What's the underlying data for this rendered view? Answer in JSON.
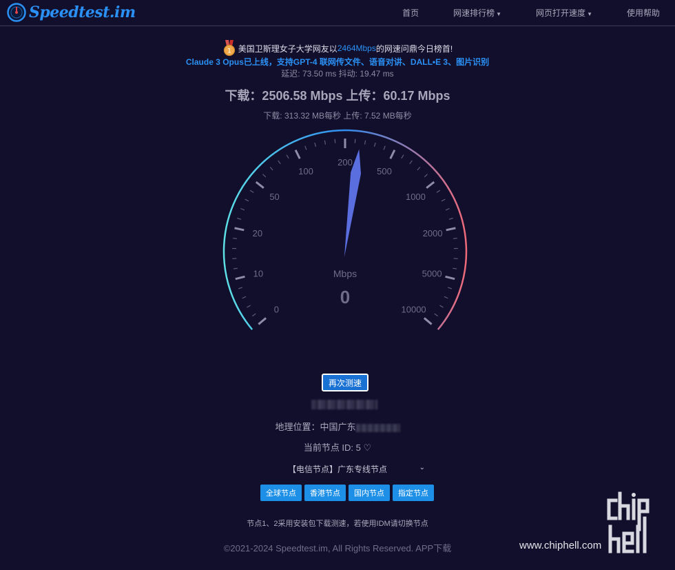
{
  "brand": {
    "name": "Speedtest.im"
  },
  "nav": {
    "items": [
      {
        "label": "首页",
        "dropdown": false
      },
      {
        "label": "网速排行榜",
        "dropdown": true
      },
      {
        "label": "网页打开速度",
        "dropdown": true
      },
      {
        "label": "使用帮助",
        "dropdown": false
      }
    ]
  },
  "announcement": {
    "prefix": "美国卫斯理女子大学网友以",
    "highlight": "2464Mbps",
    "suffix": "的网速问鼎今日榜首!"
  },
  "promo": "Claude 3 Opus已上线，支持GPT-4 联网传文件、语音对讲、DALL•E 3、图片识别",
  "latency": "延迟: 73.50 ms 抖动: 19.47 ms",
  "speeds": "下载：2506.58 Mbps 上传：60.17 Mbps",
  "speeds_mb": "下载: 313.32 MB每秒 上传: 7.52 MB每秒",
  "gauge": {
    "labels": [
      "0",
      "10",
      "20",
      "50",
      "100",
      "200",
      "500",
      "1000",
      "2000",
      "5000",
      "10000"
    ],
    "unit": "Mbps",
    "value": "0",
    "needle_fraction": 0.53,
    "colors": {
      "arc_start": "#5de0e6",
      "arc_mid": "#2f8cf0",
      "arc_end": "#f06a7a",
      "needle": "#5b6ee0"
    }
  },
  "retest_label": "再次测速",
  "location": {
    "label": "地理位置：中国广东"
  },
  "node": {
    "label": "当前节点 ID: 5",
    "heart": "♡"
  },
  "node_select": {
    "value": "【电信节点】广东专线节点"
  },
  "node_buttons": [
    "全球节点",
    "香港节点",
    "国内节点",
    "指定节点"
  ],
  "tip": "节点1、2采用安装包下载测速，若使用IDM请切换节点",
  "footer": {
    "copyright": "©2021-2024 Speedtest.im, All Rights Reserved.",
    "app": "APP下载"
  },
  "watermark": {
    "site": "www.chiphell.com"
  }
}
